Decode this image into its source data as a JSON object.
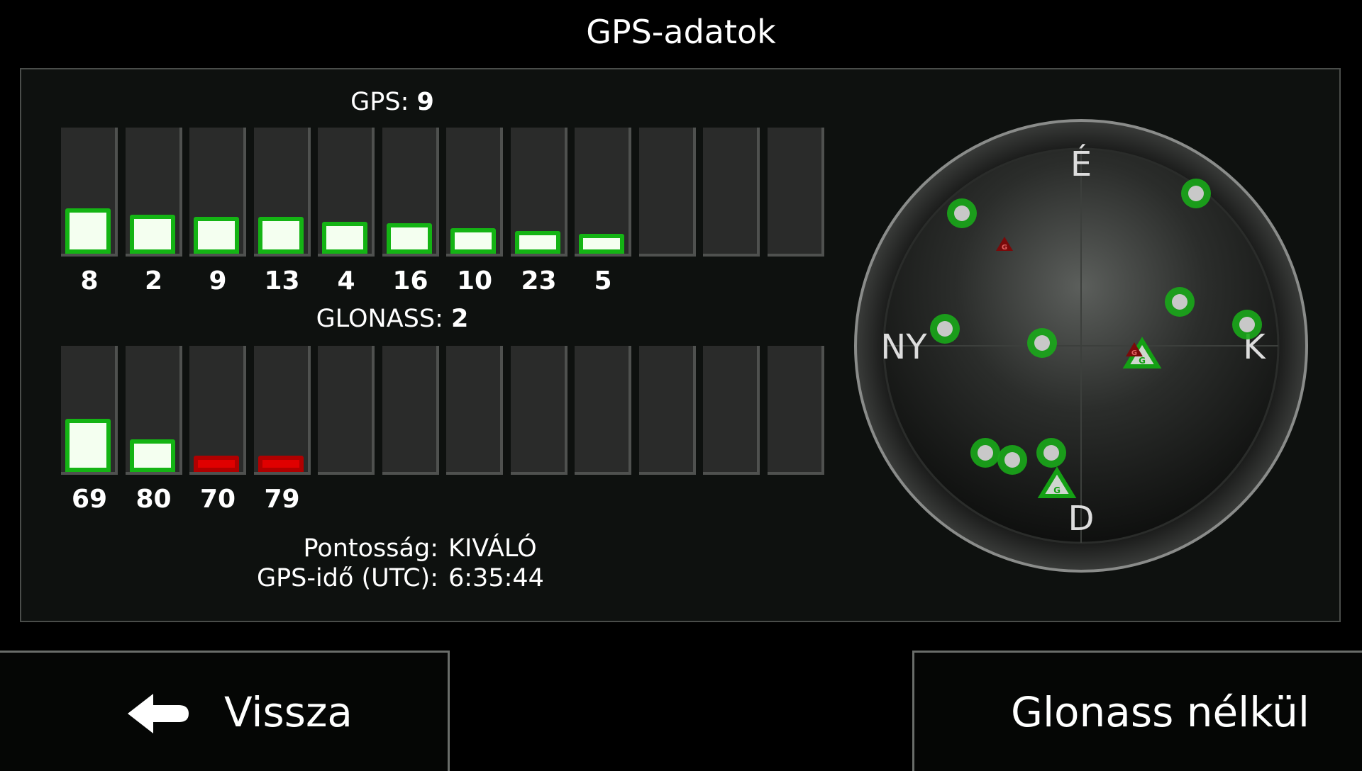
{
  "title": "GPS-adatok",
  "gps": {
    "label": "GPS:",
    "count": "9",
    "satellites": [
      {
        "prn": "8",
        "signal": 0.36
      },
      {
        "prn": "2",
        "signal": 0.31
      },
      {
        "prn": "9",
        "signal": 0.29
      },
      {
        "prn": "13",
        "signal": 0.29
      },
      {
        "prn": "4",
        "signal": 0.25
      },
      {
        "prn": "16",
        "signal": 0.24
      },
      {
        "prn": "10",
        "signal": 0.2
      },
      {
        "prn": "23",
        "signal": 0.18
      },
      {
        "prn": "5",
        "signal": 0.16
      }
    ]
  },
  "glonass": {
    "label": "GLONASS:",
    "count": "2",
    "satellites": [
      {
        "prn": "69",
        "signal": 0.42,
        "status": "used"
      },
      {
        "prn": "80",
        "signal": 0.26,
        "status": "used"
      },
      {
        "prn": "70",
        "signal": 0.13,
        "status": "weak"
      },
      {
        "prn": "79",
        "signal": 0.13,
        "status": "weak"
      }
    ]
  },
  "slot_count": 12,
  "info": {
    "accuracy_label": "Pontosság:",
    "accuracy_value": "KIVÁLÓ",
    "time_label": "GPS-idő (UTC):",
    "time_value": "6:35:44"
  },
  "compass": {
    "north": "É",
    "south": "D",
    "east": "K",
    "west": "NY"
  },
  "colors": {
    "signal_ok": "#14b414",
    "signal_fill": "#f4fff0",
    "signal_weak": "#e00000",
    "sat_dot": "#1aa81a"
  },
  "sky_icons": {
    "gps_satellite": "green-dot-icon",
    "glonass_satellite": "triangle-g-icon",
    "glonass_not_used": "red-g-icon"
  },
  "buttons": {
    "back_label": "Vissza",
    "back_icon": "arrow-left-icon",
    "glonass_label": "Glonass nélkül"
  }
}
